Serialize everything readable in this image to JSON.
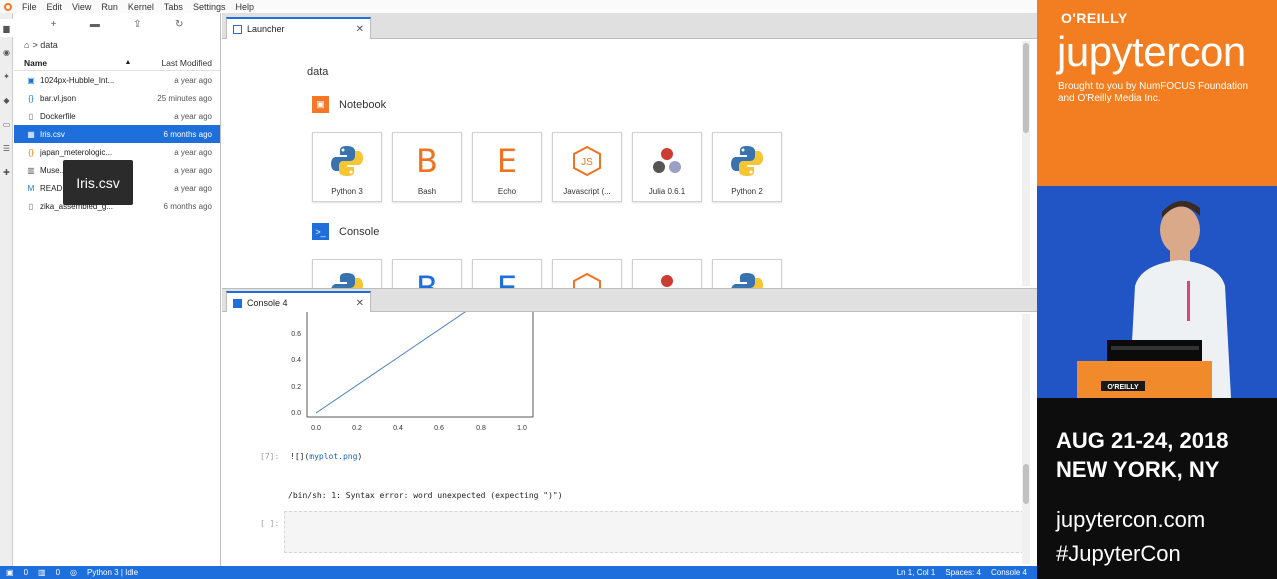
{
  "menubar": {
    "items": [
      "File",
      "Edit",
      "View",
      "Run",
      "Kernel",
      "Tabs",
      "Settings",
      "Help"
    ]
  },
  "filebrowser": {
    "breadcrumb": "data",
    "column_name": "Name",
    "column_modified": "Last Modified",
    "files": [
      {
        "name": "1024px-Hubble_Int...",
        "modified": "a year ago",
        "icon": "image-icon"
      },
      {
        "name": "bar.vl.json",
        "modified": "25 minutes ago",
        "icon": "json-icon"
      },
      {
        "name": "Dockerfile",
        "modified": "a year ago",
        "icon": "file-icon"
      },
      {
        "name": "Iris.csv",
        "modified": "6 months ago",
        "icon": "csv-icon",
        "selected": true
      },
      {
        "name": "japan_meterologic...",
        "modified": "a year ago",
        "icon": "json-icon"
      },
      {
        "name": "Muse...",
        "modified": "a year ago",
        "icon": "book-icon"
      },
      {
        "name": "READ...",
        "modified": "a year ago",
        "icon": "markdown-icon"
      },
      {
        "name": "zika_assembled_g...",
        "modified": "6 months ago",
        "icon": "file-icon"
      }
    ],
    "tooltip": "Iris.csv"
  },
  "launcher": {
    "tab_label": "Launcher",
    "cwd": "data",
    "notebook_section": "Notebook",
    "console_section": "Console",
    "kernels": [
      "Python 3",
      "Bash",
      "Echo",
      "Javascript (...",
      "Julia 0.6.1",
      "Python 2"
    ]
  },
  "console": {
    "tab_label": "Console 4",
    "plot": {
      "x_ticks": [
        "0.0",
        "0.2",
        "0.4",
        "0.6",
        "0.8",
        "1.0"
      ],
      "y_ticks": [
        "0.0",
        "0.2",
        "0.4",
        "0.6"
      ]
    },
    "cell7_prompt": "[7]:",
    "cell7_code_prefix": "![](",
    "cell7_code_arg": "myplot.png",
    "cell7_code_suffix": ")",
    "error_output": "/bin/sh: 1: Syntax error: word unexpected (expecting \")\")",
    "input_prompt": "[ ]:"
  },
  "statusbar": {
    "count_a": "0",
    "count_b": "0",
    "kernel": "Python 3 | Idle",
    "position": "Ln 1, Col 1",
    "spaces": "Spaces: 4",
    "mode": "Console 4"
  },
  "overlay": {
    "publisher": "O'REILLY",
    "event": "jupytercon",
    "brought_by": "Brought to you by NumFOCUS Foundation and O'Reilly Media Inc.",
    "podium_label": "O'REILLY",
    "date_line": "AUG 21-24, 2018",
    "city_line": "NEW YORK, NY",
    "website": "jupytercon.com",
    "hashtag": "#JupyterCon",
    "colors": {
      "orange": "#f37e21",
      "blue": "#1f53c4",
      "dark": "#0d0d0d",
      "jupyter_blue": "#1e6fdb"
    }
  }
}
